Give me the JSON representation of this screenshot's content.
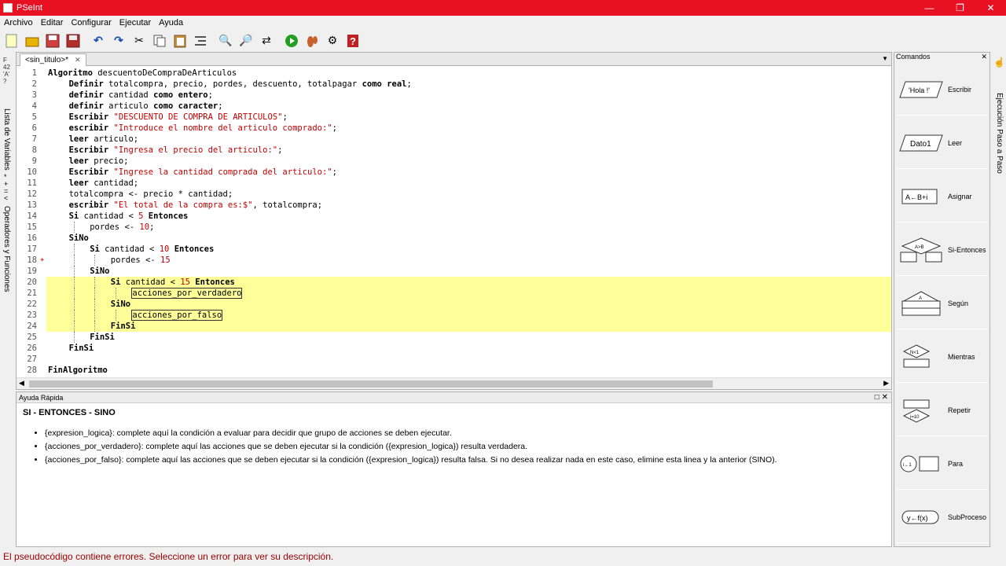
{
  "window": {
    "title": "PSeInt"
  },
  "menu": [
    "Archivo",
    "Editar",
    "Configurar",
    "Ejecutar",
    "Ayuda"
  ],
  "toolbar": [
    "new-file-icon",
    "open-folder-icon",
    "save-icon",
    "save-as-icon",
    "undo-icon",
    "redo-icon",
    "cut-icon",
    "copy-icon",
    "paste-icon",
    "indent-icon",
    "search-icon",
    "find-next-icon",
    "replace-icon",
    "run-icon",
    "step-icon",
    "debug-icon",
    "help-icon"
  ],
  "left_tabs": {
    "vars": "Lista de Variables",
    "ops": "Operadores y Funciones"
  },
  "editor": {
    "tab_label": "<sin_titulo>*",
    "lines": [
      {
        "n": "1",
        "indent": 0,
        "segs": [
          [
            "kw",
            "Algoritmo"
          ],
          [
            "t",
            " descuentoDeCompraDeArticulos"
          ]
        ]
      },
      {
        "n": "2",
        "indent": 1,
        "segs": [
          [
            "kw",
            "Definir"
          ],
          [
            "t",
            " totalcompra, precio, pordes, descuento, totalpagar "
          ],
          [
            "kw",
            "como real"
          ],
          [
            "t",
            ";"
          ]
        ]
      },
      {
        "n": "3",
        "indent": 1,
        "segs": [
          [
            "kw",
            "definir"
          ],
          [
            "t",
            " cantidad "
          ],
          [
            "kw",
            "como entero"
          ],
          [
            "t",
            ";"
          ]
        ]
      },
      {
        "n": "4",
        "indent": 1,
        "segs": [
          [
            "kw",
            "definir"
          ],
          [
            "t",
            " articulo "
          ],
          [
            "kw",
            "como caracter"
          ],
          [
            "t",
            ";"
          ]
        ]
      },
      {
        "n": "5",
        "indent": 1,
        "segs": [
          [
            "kw",
            "Escribir"
          ],
          [
            "t",
            " "
          ],
          [
            "str",
            "\"DESCUENTO DE COMPRA DE ARTICULOS\""
          ],
          [
            "t",
            ";"
          ]
        ]
      },
      {
        "n": "6",
        "indent": 1,
        "segs": [
          [
            "kw",
            "escribir"
          ],
          [
            "t",
            " "
          ],
          [
            "str",
            "\"Introduce el nombre del articulo comprado:\""
          ],
          [
            "t",
            ";"
          ]
        ]
      },
      {
        "n": "7",
        "indent": 1,
        "segs": [
          [
            "kw",
            "leer"
          ],
          [
            "t",
            " articulo;"
          ]
        ]
      },
      {
        "n": "8",
        "indent": 1,
        "segs": [
          [
            "kw",
            "Escribir"
          ],
          [
            "t",
            " "
          ],
          [
            "str",
            "\"Ingresa el precio del articulo:\""
          ],
          [
            "t",
            ";"
          ]
        ]
      },
      {
        "n": "9",
        "indent": 1,
        "segs": [
          [
            "kw",
            "leer"
          ],
          [
            "t",
            " precio;"
          ]
        ]
      },
      {
        "n": "10",
        "indent": 1,
        "segs": [
          [
            "kw",
            "Escribir"
          ],
          [
            "t",
            " "
          ],
          [
            "str",
            "\"Ingrese la cantidad comprada del articulo:\""
          ],
          [
            "t",
            ";"
          ]
        ]
      },
      {
        "n": "11",
        "indent": 1,
        "segs": [
          [
            "kw",
            "leer"
          ],
          [
            "t",
            " cantidad;"
          ]
        ]
      },
      {
        "n": "12",
        "indent": 1,
        "segs": [
          [
            "t",
            "totalcompra <- precio * cantidad;"
          ]
        ]
      },
      {
        "n": "13",
        "indent": 1,
        "segs": [
          [
            "kw",
            "escribir"
          ],
          [
            "t",
            " "
          ],
          [
            "str",
            "\"El total de la compra es:$\""
          ],
          [
            "t",
            ", totalcompra;"
          ]
        ]
      },
      {
        "n": "14",
        "indent": 1,
        "segs": [
          [
            "kw",
            "Si"
          ],
          [
            "t",
            " cantidad < "
          ],
          [
            "num",
            "5"
          ],
          [
            "t",
            " "
          ],
          [
            "kw",
            "Entonces"
          ]
        ]
      },
      {
        "n": "15",
        "indent": 2,
        "segs": [
          [
            "t",
            "pordes <- "
          ],
          [
            "num",
            "10"
          ],
          [
            "t",
            ";"
          ]
        ]
      },
      {
        "n": "16",
        "indent": 1,
        "segs": [
          [
            "kw",
            "SiNo"
          ]
        ]
      },
      {
        "n": "17",
        "indent": 2,
        "segs": [
          [
            "kw",
            "Si"
          ],
          [
            "t",
            " cantidad < "
          ],
          [
            "num",
            "10"
          ],
          [
            "t",
            " "
          ],
          [
            "kw",
            "Entonces"
          ]
        ]
      },
      {
        "n": "18",
        "indent": 3,
        "marker": "+",
        "segs": [
          [
            "t",
            "pordes <- "
          ],
          [
            "num",
            "15"
          ]
        ]
      },
      {
        "n": "19",
        "indent": 2,
        "segs": [
          [
            "kw",
            "SiNo"
          ]
        ]
      },
      {
        "n": "20",
        "indent": 3,
        "hl": true,
        "segs": [
          [
            "kw",
            "Si"
          ],
          [
            "t",
            " cantidad < "
          ],
          [
            "num",
            "15"
          ],
          [
            "t",
            " "
          ],
          [
            "kw",
            "Entonces"
          ]
        ]
      },
      {
        "n": "21",
        "indent": 4,
        "hl": true,
        "segs": [
          [
            "box",
            "acciones_por_verdadero"
          ]
        ]
      },
      {
        "n": "22",
        "indent": 3,
        "hl": true,
        "segs": [
          [
            "kw",
            "SiNo"
          ]
        ]
      },
      {
        "n": "23",
        "indent": 4,
        "hl": true,
        "segs": [
          [
            "box",
            "acciones_por_falso"
          ]
        ]
      },
      {
        "n": "24",
        "indent": 3,
        "hl": true,
        "segs": [
          [
            "kw",
            "FinSi"
          ]
        ]
      },
      {
        "n": "25",
        "indent": 2,
        "segs": [
          [
            "kw",
            "FinSi"
          ]
        ]
      },
      {
        "n": "26",
        "indent": 1,
        "segs": [
          [
            "kw",
            "FinSi"
          ]
        ]
      },
      {
        "n": "27",
        "indent": 0,
        "segs": []
      },
      {
        "n": "28",
        "indent": 0,
        "segs": [
          [
            "kw",
            "FinAlgoritmo"
          ]
        ]
      }
    ]
  },
  "help": {
    "header": "Ayuda Rápida",
    "title": "SI - ENTONCES - SINO",
    "items": [
      "{expresion_logica}: complete aquí la condición a evaluar para decidir que grupo de acciones se deben ejecutar.",
      "{acciones_por_verdadero}: complete aquí las acciones que se deben ejecutar si la condición ({expresion_logica}) resulta verdadera.",
      "{acciones_por_falso}: complete aquí las acciones que se deben ejecutar si la condición ({expresion_logica}) resulta falsa. Si no desea realizar nada en este caso, elimine esta linea y la anterior (SINO)."
    ]
  },
  "commands": {
    "header": "Comandos",
    "items": [
      {
        "label": "Escribir",
        "sym": "'Hola !'"
      },
      {
        "label": "Leer",
        "sym": "Dato1"
      },
      {
        "label": "Asignar",
        "sym": "A←B+i"
      },
      {
        "label": "Si-Entonces",
        "sym": "A>B"
      },
      {
        "label": "Según",
        "sym": "A"
      },
      {
        "label": "Mientras",
        "sym": "N<1"
      },
      {
        "label": "Repetir",
        "sym": "i=10"
      },
      {
        "label": "Para",
        "sym": "i←1"
      },
      {
        "label": "SubProceso",
        "sym": "y←f(x)"
      }
    ]
  },
  "right_tab": "Ejecución Paso a Paso",
  "status": "El pseudocódigo contiene errores. Seleccione un error para ver su descripción."
}
